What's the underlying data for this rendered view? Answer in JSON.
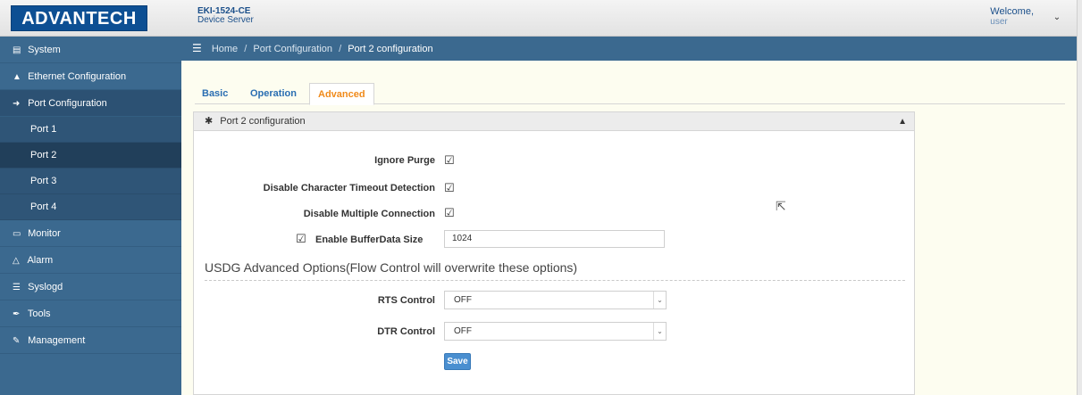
{
  "header": {
    "logo_text": "ADVANTECH",
    "model": "EKI-1524-CE",
    "device_type": "Device Server",
    "welcome": "Welcome,",
    "user": "user",
    "user_menu_icon": "chevron-down-icon"
  },
  "sidebar": {
    "items": [
      {
        "label": "System",
        "icon": "system-icon"
      },
      {
        "label": "Ethernet Configuration",
        "icon": "network-icon"
      },
      {
        "label": "Port Configuration",
        "icon": "plug-icon"
      },
      {
        "label": "Monitor",
        "icon": "monitor-icon"
      },
      {
        "label": "Alarm",
        "icon": "bell-icon"
      },
      {
        "label": "Syslogd",
        "icon": "list-icon"
      },
      {
        "label": "Tools",
        "icon": "wrench-icon"
      },
      {
        "label": "Management",
        "icon": "edit-icon"
      }
    ],
    "ports": [
      "Port 1",
      "Port 2",
      "Port 3",
      "Port 4"
    ],
    "active_port": "Port 2"
  },
  "breadcrumb": {
    "home": "Home",
    "section": "Port Configuration",
    "current": "Port 2 configuration",
    "separator": "/"
  },
  "tabs": [
    "Basic",
    "Operation",
    "Advanced"
  ],
  "active_tab": "Advanced",
  "panel": {
    "title": "Port 2 configuration",
    "fields": {
      "ignore_purge": {
        "label": "Ignore Purge",
        "checked": true
      },
      "disable_char_timeout": {
        "label": "Disable Character Timeout Detection",
        "checked": true
      },
      "disable_multi_conn": {
        "label": "Disable Multiple Connection",
        "checked": true
      },
      "buffer_size": {
        "label": "Enable BufferData Size",
        "checked": true,
        "value": "1024"
      }
    },
    "section_title": "USDG Advanced Options(Flow Control will overwrite these options)",
    "rts": {
      "label": "RTS Control",
      "value": "OFF"
    },
    "dtr": {
      "label": "DTR Control",
      "value": "OFF"
    },
    "save_label": "Save"
  },
  "colors": {
    "sidebar_bg": "#3b698f",
    "brand_blue": "#0d4f93",
    "tab_active": "#f08a1a",
    "tab_link": "#2a6eb2",
    "save_button": "#4a8fd0"
  }
}
